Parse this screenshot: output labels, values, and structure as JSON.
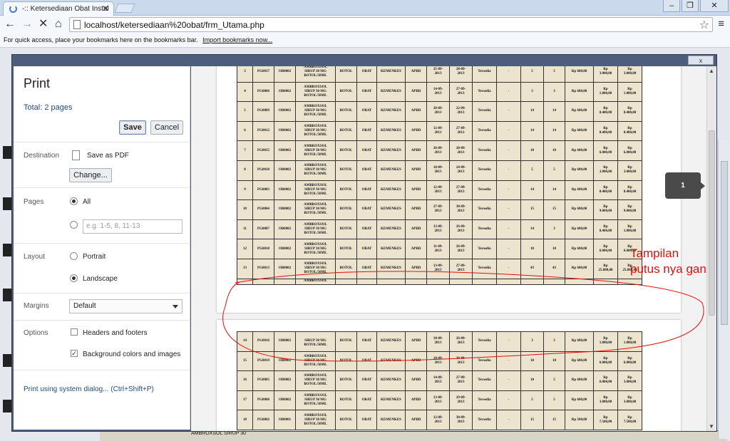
{
  "browser": {
    "tab_title": "-:: Ketersediaan Obat Instal",
    "tab_close": "✕",
    "window_buttons": [
      "–",
      "❐",
      "✕"
    ],
    "url": "localhost/ketersediaan%20obat/frm_Utama.php",
    "bookmarks_text": "For quick access, place your bookmarks here on the bookmarks bar.",
    "bookmarks_link": "Import bookmarks now...",
    "nav": {
      "back": "←",
      "forward": "→",
      "stop": "✕",
      "home": "⌂"
    }
  },
  "dialog": {
    "close": "x",
    "title": "Print",
    "total": "Total: 2 pages",
    "save": "Save",
    "cancel": "Cancel",
    "destination_label": "Destination",
    "destination_value": "Save as PDF",
    "change": "Change...",
    "pages_label": "Pages",
    "pages_all": "All",
    "pages_placeholder": "e.g. 1-5, 8, 11-13",
    "layout_label": "Layout",
    "portrait": "Portrait",
    "landscape": "Landscape",
    "margins_label": "Margins",
    "margins_value": "Default",
    "options_label": "Options",
    "headers_footers": "Headers and footers",
    "background": "Background colors and images",
    "system_dialog": "Print using system dialog... (Ctrl+Shift+P)"
  },
  "page_badge": "1",
  "annotation": [
    "Tampilan",
    "putus nya gan"
  ],
  "background_strip": "AMBROXSOL SIRUP 30",
  "page1_rows": [
    {
      "no": "3",
      "id": "PG0017",
      "kode": "OB0002",
      "nama": [
        "AMBROXSOL",
        "SIRUP 30 MG",
        "BOTOL/50ML"
      ],
      "sat": "BOTOL",
      "jenis": "OBAT",
      "sumber": "KEMENKES",
      "dana": "APBD",
      "tgl1": [
        "25-09-",
        "2013"
      ],
      "tgl2": [
        "28-09-",
        "2013"
      ],
      "status": "Tersedia",
      "ket": "-",
      "q1": "5",
      "q2": "5",
      "harga": "Rp 600,00",
      "tot1": [
        "Rp",
        "3.000,00"
      ],
      "tot2": [
        "Rp",
        "3.000,00"
      ]
    },
    {
      "no": "4",
      "id": "PG0006",
      "kode": "OB0002",
      "nama": [
        "AMBROXSOL",
        "SIRUP 30 MG",
        "BOTOL/50ML"
      ],
      "sat": "BOTOL",
      "jenis": "OBAT",
      "sumber": "KEMENKES",
      "dana": "APBD",
      "tgl1": [
        "14-09-",
        "2013"
      ],
      "tgl2": [
        "27-09-",
        "2013"
      ],
      "status": "Tersedia",
      "ket": "-",
      "q1": "3",
      "q2": "3",
      "harga": "Rp 600,00",
      "tot1": [
        "Rp",
        "1.800,00"
      ],
      "tot2": [
        "Rp",
        "1.800,00"
      ]
    },
    {
      "no": "5",
      "id": "PG0009",
      "kode": "OB0002",
      "nama": [
        "AMBROXSOL",
        "SIRUP 30 MG",
        "BOTOL/50ML"
      ],
      "sat": "BOTOL",
      "jenis": "OBAT",
      "sumber": "KEMENKES",
      "dana": "APBD",
      "tgl1": [
        "20-09-",
        "2013"
      ],
      "tgl2": [
        "22-09-",
        "2013"
      ],
      "status": "Tersedia",
      "ket": "-",
      "q1": "14",
      "q2": "14",
      "harga": "Rp 600,00",
      "tot1": [
        "Rp",
        "8.400,00"
      ],
      "tot2": [
        "Rp",
        "8.400,00"
      ]
    },
    {
      "no": "6",
      "id": "PG0012",
      "kode": "OB0002",
      "nama": [
        "AMBROXSOL",
        "SIRUP 30 MG",
        "BOTOL/50ML"
      ],
      "sat": "BOTOL",
      "jenis": "OBAT",
      "sumber": "KEMENKES",
      "dana": "APBD",
      "tgl1": [
        "12-09-",
        "2013"
      ],
      "tgl2": [
        "27-09-",
        "2013"
      ],
      "status": "Tersedia",
      "ket": "-",
      "q1": "14",
      "q2": "14",
      "harga": "Rp 600,00",
      "tot1": [
        "Rp",
        "8.400,00"
      ],
      "tot2": [
        "Rp",
        "8.400,00"
      ]
    },
    {
      "no": "7",
      "id": "PG0015",
      "kode": "OB0002",
      "nama": [
        "AMBROXSOL",
        "SIRUP 30 MG",
        "BOTOL/50ML"
      ],
      "sat": "BOTOL",
      "jenis": "OBAT",
      "sumber": "KEMENKES",
      "dana": "APBD",
      "tgl1": [
        "26-09-",
        "2013"
      ],
      "tgl2": [
        "28-09-",
        "2013"
      ],
      "status": "Tersedia",
      "ket": "-",
      "q1": "10",
      "q2": "10",
      "harga": "Rp 600,00",
      "tot1": [
        "Rp",
        "6.000,00"
      ],
      "tot2": [
        "Rp",
        "6.000,00"
      ]
    },
    {
      "no": "8",
      "id": "PG0018",
      "kode": "OB0002",
      "nama": [
        "AMBROXSOL",
        "SIRUP 30 MG",
        "BOTOL/50ML"
      ],
      "sat": "BOTOL",
      "jenis": "OBAT",
      "sumber": "KEMENKES",
      "dana": "APBD",
      "tgl1": [
        "18-09-",
        "2013"
      ],
      "tgl2": [
        "24-09-",
        "2013"
      ],
      "status": "Tersedia",
      "ket": "-",
      "q1": "5",
      "q2": "5",
      "harga": "Rp 600,00",
      "tot1": [
        "Rp",
        "3.000,00"
      ],
      "tot2": [
        "Rp",
        "3.000,00"
      ]
    },
    {
      "no": "9",
      "id": "PG0003",
      "kode": "OB0002",
      "nama": [
        "AMBROXSOL",
        "SIRUP 30 MG",
        "BOTOL/50ML"
      ],
      "sat": "BOTOL",
      "jenis": "OBAT",
      "sumber": "KEMENKES",
      "dana": "APBD",
      "tgl1": [
        "12-09-",
        "2013"
      ],
      "tgl2": [
        "27-09-",
        "2013"
      ],
      "status": "Tersedia",
      "ket": "-",
      "q1": "14",
      "q2": "14",
      "harga": "Rp 600,00",
      "tot1": [
        "Rp",
        "8.400,00"
      ],
      "tot2": [
        "Rp",
        "8.400,00"
      ]
    },
    {
      "no": "10",
      "id": "PG0004",
      "kode": "OB0002",
      "nama": [
        "AMBROXSOL",
        "SIRUP 30 MG",
        "BOTOL/50ML"
      ],
      "sat": "BOTOL",
      "jenis": "OBAT",
      "sumber": "KEMENKES",
      "dana": "APBD",
      "tgl1": [
        "27-09-",
        "2013"
      ],
      "tgl2": [
        "30-09-",
        "2013"
      ],
      "status": "Tersedia",
      "ket": "-",
      "q1": "15",
      "q2": "15",
      "harga": "Rp 600,00",
      "tot1": [
        "Rp",
        "9.000,00"
      ],
      "tot2": [
        "Rp",
        "9.000,00"
      ]
    },
    {
      "no": "11",
      "id": "PG0007",
      "kode": "OB0002",
      "nama": [
        "AMBROXSOL",
        "SIRUP 30 MG",
        "BOTOL/50ML"
      ],
      "sat": "BOTOL",
      "jenis": "OBAT",
      "sumber": "KEMENKES",
      "dana": "APBD",
      "tgl1": [
        "13-09-",
        "2013"
      ],
      "tgl2": [
        "26-09-",
        "2013"
      ],
      "status": "Tersedia",
      "ket": "-",
      "q1": "14",
      "q2": "3",
      "harga": "Rp 600,00",
      "tot1": [
        "Rp",
        "8.400,00"
      ],
      "tot2": [
        "Rp",
        "1.800,00"
      ]
    },
    {
      "no": "12",
      "id": "PG0010",
      "kode": "OB0002",
      "nama": [
        "AMBROXSOL",
        "SIRUP 30 MG",
        "BOTOL/50ML"
      ],
      "sat": "BOTOL",
      "jenis": "OBAT",
      "sumber": "KEMENKES",
      "dana": "APBD",
      "tgl1": [
        "11-09-",
        "2013"
      ],
      "tgl2": [
        "26-09-",
        "2013"
      ],
      "status": "Tersedia",
      "ket": "-",
      "q1": "10",
      "q2": "10",
      "harga": "Rp 600,00",
      "tot1": [
        "Rp",
        "6.000,00"
      ],
      "tot2": [
        "Rp",
        "6.000,00"
      ]
    },
    {
      "no": "13",
      "id": "PG0013",
      "kode": "OB0002",
      "nama": [
        "AMBROXSOL",
        "SIRUP 30 MG",
        "BOTOL/50ML"
      ],
      "sat": "BOTOL",
      "jenis": "OBAT",
      "sumber": "KEMENKES",
      "dana": "APBD",
      "tgl1": [
        "13-09-",
        "2013"
      ],
      "tgl2": [
        "27-09-",
        "2013"
      ],
      "status": "Tersedia",
      "ket": "-",
      "q1": "43",
      "q2": "43",
      "harga": "Rp 600,00",
      "tot1": [
        "Rp",
        "25.800,00"
      ],
      "tot2": [
        "Rp",
        "25.800,00"
      ]
    }
  ],
  "page1_cut_label": "AMBROXSOL",
  "page2_rows": [
    {
      "no": "14",
      "id": "PG0016",
      "kode": "OB0002",
      "nama": [
        "",
        "SIRUP 30 MG",
        "BOTOL/50ML"
      ],
      "sat": "BOTOL",
      "jenis": "OBAT",
      "sumber": "KEMENKES",
      "dana": "APBD",
      "tgl1": [
        "18-09-",
        "2013"
      ],
      "tgl2": [
        "26-09-",
        "2013"
      ],
      "status": "Tersedia",
      "ket": "-",
      "q1": "3",
      "q2": "3",
      "harga": "Rp 600,00",
      "tot1": [
        "Rp",
        "1.800,00"
      ],
      "tot2": [
        "Rp",
        "1.800,00"
      ]
    },
    {
      "no": "15",
      "id": "PG0019",
      "kode": "OB0002",
      "nama": [
        "AMBROXSOL",
        "SIRUP 30 MG",
        "BOTOL/50ML"
      ],
      "sat": "BOTOL",
      "jenis": "OBAT",
      "sumber": "KEMENKES",
      "dana": "APBD",
      "tgl1": [
        "10-09-",
        "2013"
      ],
      "tgl2": [
        "30-09-",
        "2013"
      ],
      "status": "Tersedia",
      "ket": "-",
      "q1": "10",
      "q2": "10",
      "harga": "Rp 600,00",
      "tot1": [
        "Rp",
        "6.000,00"
      ],
      "tot2": [
        "Rp",
        "6.000,00"
      ]
    },
    {
      "no": "16",
      "id": "PG0005",
      "kode": "OB0002",
      "nama": [
        "AMBROXSOL",
        "SIRUP 30 MG",
        "BOTOL/50ML"
      ],
      "sat": "BOTOL",
      "jenis": "OBAT",
      "sumber": "KEMENKES",
      "dana": "APBD",
      "tgl1": [
        "14-09-",
        "2013"
      ],
      "tgl2": [
        "27-09-",
        "2013"
      ],
      "status": "Tersedia",
      "ket": "-",
      "q1": "10",
      "q2": "5",
      "harga": "Rp 600,00",
      "tot1": [
        "Rp",
        "6.000,00"
      ],
      "tot2": [
        "Rp",
        "3.000,00"
      ]
    },
    {
      "no": "17",
      "id": "PG0008",
      "kode": "OB0002",
      "nama": [
        "AMBROXSOL",
        "SIRUP 30 MG",
        "BOTOL/50ML"
      ],
      "sat": "BOTOL",
      "jenis": "OBAT",
      "sumber": "KEMENKES",
      "dana": "APBD",
      "tgl1": [
        "13-09-",
        "2013"
      ],
      "tgl2": [
        "29-09-",
        "2013"
      ],
      "status": "Tersedia",
      "ket": "-",
      "q1": "5",
      "q2": "5",
      "harga": "Rp 600,00",
      "tot1": [
        "Rp",
        "3.000,00"
      ],
      "tot2": [
        "Rp",
        "3.000,00"
      ]
    },
    {
      "no": "18",
      "id": "PG0002",
      "kode": "OB0001",
      "nama": [
        "AMBROXSOL",
        "SIRUP 30 MG",
        "BOTOL/50ML"
      ],
      "sat": "BOTOL",
      "jenis": "OBAT",
      "sumber": "KEMENKES",
      "dana": "APBD",
      "tgl1": [
        "12-09-",
        "2013"
      ],
      "tgl2": [
        "30-09-",
        "2013"
      ],
      "status": "Tersedia",
      "ket": "-",
      "q1": "15",
      "q2": "15",
      "harga": "Rp 500,00",
      "tot1": [
        "Rp",
        "7.500,00"
      ],
      "tot2": [
        "Rp",
        "7.500,00"
      ]
    }
  ]
}
